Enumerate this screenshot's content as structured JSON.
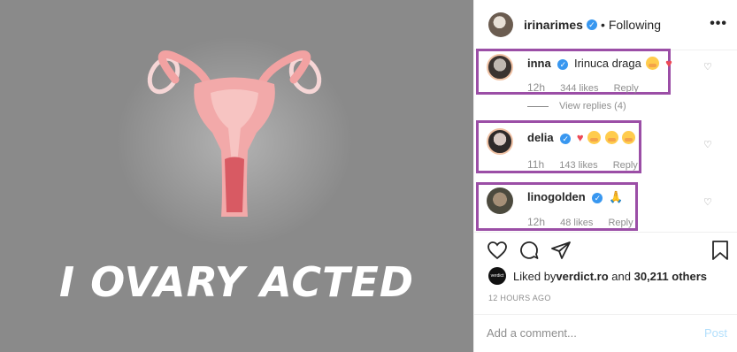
{
  "image": {
    "caption": "I OVARY ACTED"
  },
  "header": {
    "username": "irinarimes",
    "separator": "•",
    "follow_status": "Following",
    "more_label": "•••"
  },
  "comments": [
    {
      "username": "inna",
      "text": "Irinuca draga",
      "time": "12h",
      "likes": "344 likes",
      "reply": "Reply"
    },
    {
      "username": "delia",
      "text": "",
      "time": "11h",
      "likes": "143 likes",
      "reply": "Reply"
    },
    {
      "username": "linogolden",
      "text": "",
      "time": "12h",
      "likes": "48 likes",
      "reply": "Reply"
    }
  ],
  "view_replies": "View replies (4)",
  "likes_summary": {
    "prefix": "Liked by ",
    "account": "verdict.ro",
    "middle": " and ",
    "others": "30,211 others"
  },
  "time_ago": "12 HOURS AGO",
  "add_comment": {
    "placeholder": "Add a comment...",
    "post_label": "Post"
  },
  "colors": {
    "highlight_frame": "#9b4ea6",
    "verified_badge": "#3897f0",
    "post_disabled": "#b2dffc"
  }
}
